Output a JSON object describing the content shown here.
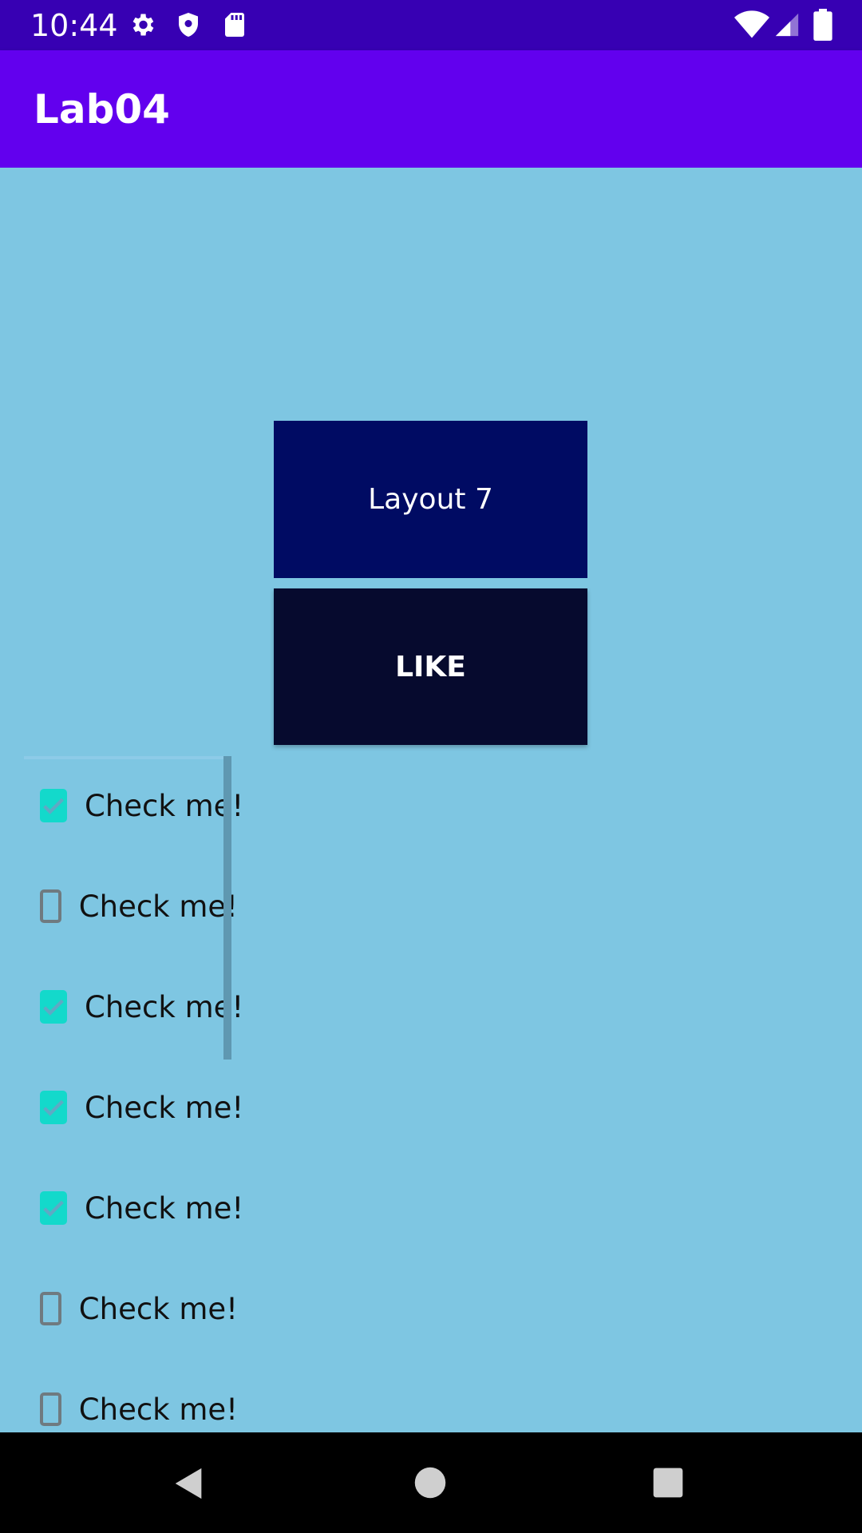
{
  "status_bar": {
    "time": "10:44",
    "icons": [
      "gear-icon",
      "shield-icon",
      "sd-card-icon",
      "wifi-icon",
      "signal-icon",
      "battery-icon"
    ]
  },
  "app_bar": {
    "title": "Lab04"
  },
  "main": {
    "layout_label": "Layout 7",
    "like_label": "LIKE",
    "colors": {
      "background": "#7ec6e2",
      "layout_box": "#000b63",
      "like_button": "#060a2e",
      "checkbox_checked": "#13d9cb"
    },
    "checkboxes": [
      {
        "label": "Check me!",
        "checked": true
      },
      {
        "label": "Check me!",
        "checked": false
      },
      {
        "label": "Check me!",
        "checked": true
      },
      {
        "label": "Check me!",
        "checked": true
      },
      {
        "label": "Check me!",
        "checked": true
      },
      {
        "label": "Check me!",
        "checked": false
      },
      {
        "label": "Check me!",
        "checked": false
      }
    ]
  },
  "nav_bar": {
    "buttons": [
      "back-icon",
      "home-icon",
      "recents-icon"
    ]
  }
}
